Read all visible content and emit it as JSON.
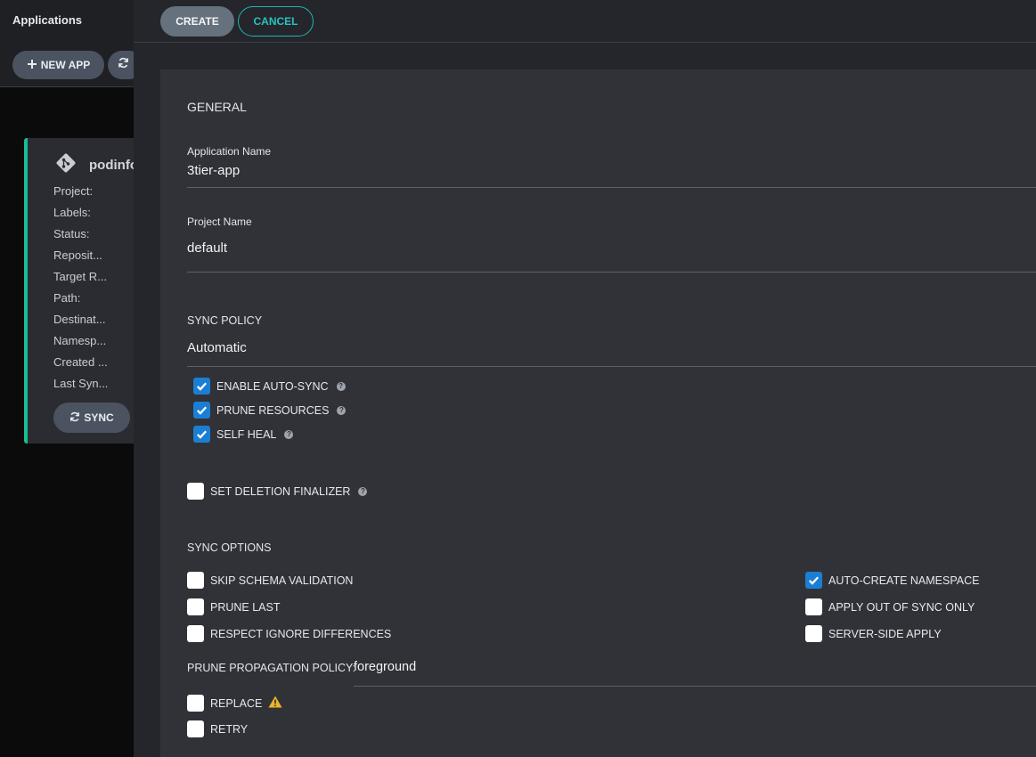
{
  "sidebar": {
    "title": "Applications",
    "new_app_label": "NEW APP",
    "refresh_icon": "refresh-icon"
  },
  "app_card": {
    "name": "podinfo",
    "fields": [
      "Project:",
      "Labels:",
      "Status:",
      "Reposit...",
      "Target R...",
      "Path:",
      "Destinat...",
      "Namesp...",
      "Created ...",
      "Last Syn..."
    ],
    "sync_label": "SYNC",
    "status_color": "#18be94"
  },
  "toolbar": {
    "create_label": "CREATE",
    "cancel_label": "CANCEL"
  },
  "form": {
    "general": {
      "title": "GENERAL",
      "app_name_label": "Application Name",
      "app_name_value": "3tier-app",
      "project_label": "Project Name",
      "project_value": "default"
    },
    "sync_policy": {
      "title": "SYNC POLICY",
      "value": "Automatic",
      "enable_auto_sync": {
        "label": "ENABLE AUTO-SYNC",
        "checked": true
      },
      "prune_resources": {
        "label": "PRUNE RESOURCES",
        "checked": true
      },
      "self_heal": {
        "label": "SELF HEAL",
        "checked": true
      }
    },
    "deletion_finalizer": {
      "label": "SET DELETION FINALIZER",
      "checked": false
    },
    "sync_options": {
      "title": "SYNC OPTIONS",
      "skip_schema": {
        "label": "SKIP SCHEMA VALIDATION",
        "checked": false
      },
      "prune_last": {
        "label": "PRUNE LAST",
        "checked": false
      },
      "respect_ignore": {
        "label": "RESPECT IGNORE DIFFERENCES",
        "checked": false
      },
      "auto_create_ns": {
        "label": "AUTO-CREATE NAMESPACE",
        "checked": true
      },
      "apply_out_of_sync": {
        "label": "APPLY OUT OF SYNC ONLY",
        "checked": false
      },
      "server_side_apply": {
        "label": "SERVER-SIDE APPLY",
        "checked": false
      },
      "prune_propagation_label": "PRUNE PROPAGATION POLICY:",
      "prune_propagation_value": "foreground",
      "replace": {
        "label": "REPLACE",
        "checked": false
      },
      "retry": {
        "label": "RETRY",
        "checked": false
      }
    }
  },
  "colors": {
    "accent_teal": "#1fb5b4",
    "checkbox_checked": "#1a7fd4",
    "warning": "#f0b32a"
  }
}
